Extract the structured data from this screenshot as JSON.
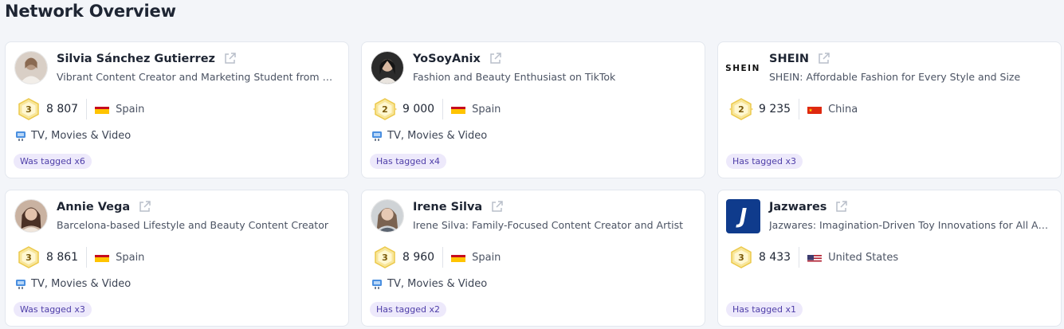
{
  "page": {
    "title": "Network Overview"
  },
  "cards": [
    {
      "name": "Silvia Sánchez Gutierrez",
      "description": "Vibrant Content Creator and Marketing Student from Spain",
      "tier": "3",
      "score": "8 807",
      "country": "Spain",
      "flag": "spain-flag",
      "category": "TV, Movies & Video",
      "tag": "Was tagged x6",
      "avatar": "person-photo"
    },
    {
      "name": "YoSoyAnix",
      "description": "Fashion and Beauty Enthusiast on TikTok",
      "tier": "2",
      "score": "9 000",
      "country": "Spain",
      "flag": "spain-flag",
      "category": "TV, Movies & Video",
      "tag": "Has tagged x4",
      "avatar": "person-photo"
    },
    {
      "name": "SHEIN",
      "description": "SHEIN: Affordable Fashion for Every Style and Size",
      "tier": "2",
      "score": "9 235",
      "country": "China",
      "flag": "china-flag",
      "category": "",
      "tag": "Has tagged x3",
      "avatar": "shein-logo",
      "logo_text": "SHEIN"
    },
    {
      "name": "Annie Vega",
      "description": "Barcelona-based Lifestyle and Beauty Content Creator",
      "tier": "3",
      "score": "8 861",
      "country": "Spain",
      "flag": "spain-flag",
      "category": "TV, Movies & Video",
      "tag": "Was tagged x3",
      "avatar": "person-photo"
    },
    {
      "name": "Irene Silva",
      "description": "Irene Silva: Family-Focused Content Creator and Artist",
      "tier": "3",
      "score": "8 960",
      "country": "Spain",
      "flag": "spain-flag",
      "category": "TV, Movies & Video",
      "tag": "Has tagged x2",
      "avatar": "person-photo"
    },
    {
      "name": "Jazwares",
      "description": "Jazwares: Imagination-Driven Toy Innovations for All Ages",
      "tier": "3",
      "score": "8 433",
      "country": "United States",
      "flag": "us-flag",
      "category": "",
      "tag": "Has tagged x1",
      "avatar": "jazwares-logo",
      "logo_text": "J"
    }
  ],
  "colors": {
    "tag_bg": "#ede9fb",
    "tag_text": "#4e3ea8",
    "badge_gold": "#f5d66b"
  }
}
